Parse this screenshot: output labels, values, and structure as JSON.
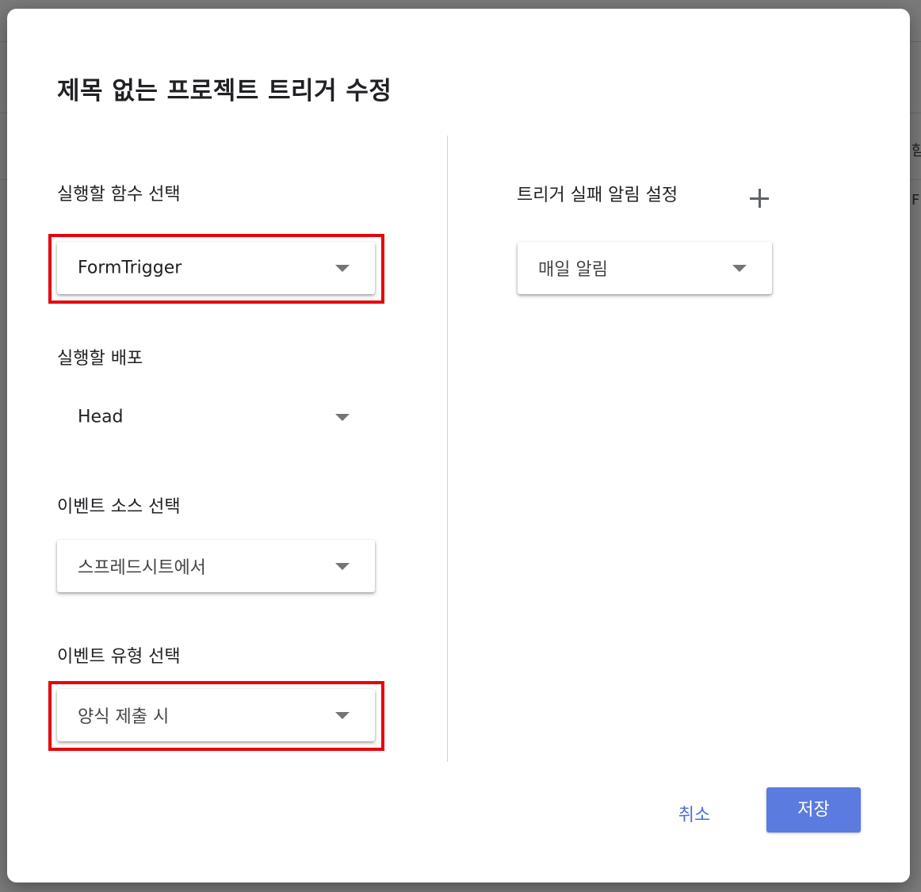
{
  "background": {
    "peek_texts": [
      "함",
      "F"
    ]
  },
  "dialog": {
    "title": "제목 없는 프로젝트 트리거 수정",
    "function": {
      "label": "실행할 함수 선택",
      "value": "FormTrigger"
    },
    "deployment": {
      "label": "실행할 배포",
      "value": "Head"
    },
    "event_source": {
      "label": "이벤트 소스 선택",
      "value": "스프레드시트에서"
    },
    "event_type": {
      "label": "이벤트 유형 선택",
      "value": "양식 제출 시"
    },
    "failure_notification": {
      "label": "트리거 실패 알림 설정",
      "add_icon": "plus-icon",
      "value": "매일 알림"
    },
    "buttons": {
      "cancel": "취소",
      "save": "저장"
    }
  },
  "colors": {
    "highlight": "#e8000b",
    "primary": "#5b7be0",
    "cancel_text": "#4a6fd9"
  }
}
